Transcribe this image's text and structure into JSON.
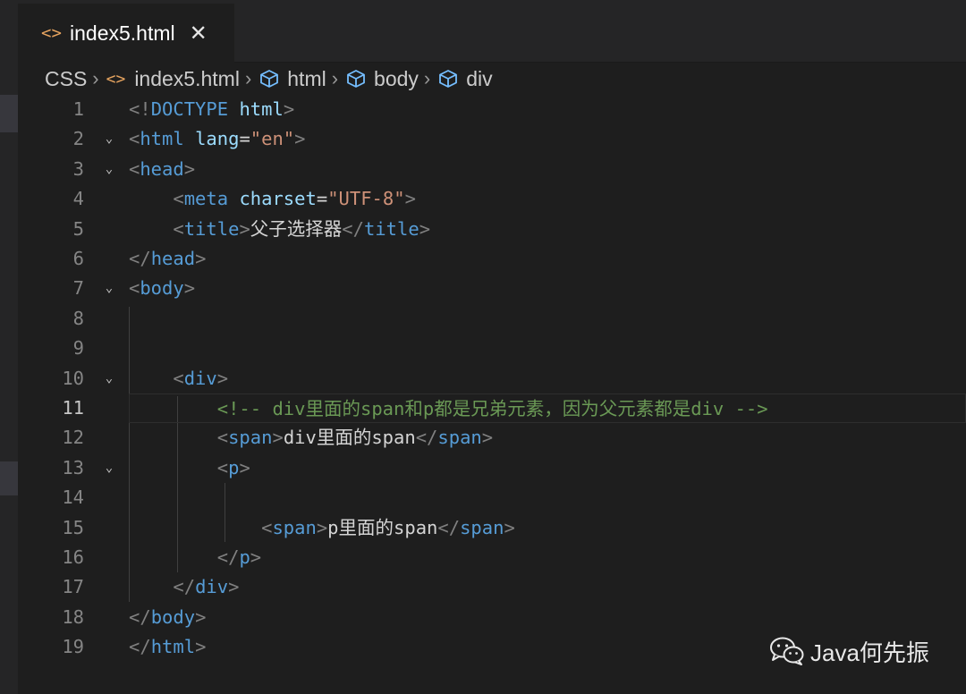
{
  "tab": {
    "icon": "html-tag-icon",
    "filename": "index5.html",
    "close_icon": "close-icon"
  },
  "breadcrumb": [
    {
      "label": "CSS",
      "icon": ""
    },
    {
      "label": "index5.html",
      "icon": "html-tag-icon"
    },
    {
      "label": "html",
      "icon": "element-cube-icon"
    },
    {
      "label": "body",
      "icon": "element-cube-icon"
    },
    {
      "label": "div",
      "icon": "element-cube-icon"
    }
  ],
  "editor": {
    "active_line": 11,
    "lines": [
      {
        "n": "1",
        "text": "<!DOCTYPE html>"
      },
      {
        "n": "2",
        "text": "<html lang=\"en\">"
      },
      {
        "n": "3",
        "text": "<head>"
      },
      {
        "n": "4",
        "text": "    <meta charset=\"UTF-8\">"
      },
      {
        "n": "5",
        "text": "    <title>父子选择器</title>"
      },
      {
        "n": "6",
        "text": "</head>"
      },
      {
        "n": "7",
        "text": "<body>"
      },
      {
        "n": "8",
        "text": ""
      },
      {
        "n": "9",
        "text": ""
      },
      {
        "n": "10",
        "text": "    <div>"
      },
      {
        "n": "11",
        "text": "        <!-- div里面的span和p都是兄弟元素，因为父元素都是div -->"
      },
      {
        "n": "12",
        "text": "        <span>div里面的span</span>"
      },
      {
        "n": "13",
        "text": "        <p>"
      },
      {
        "n": "14",
        "text": ""
      },
      {
        "n": "15",
        "text": "            <span>p里面的span</span>"
      },
      {
        "n": "16",
        "text": "        </p>"
      },
      {
        "n": "17",
        "text": "    </div>"
      },
      {
        "n": "18",
        "text": "</body>"
      },
      {
        "n": "19",
        "text": "</html>"
      }
    ]
  },
  "watermark": {
    "icon": "wechat-icon",
    "text": "Java何先振"
  },
  "colors": {
    "background": "#1e1e1e",
    "tag": "#569cd6",
    "attribute": "#9cdcfe",
    "string": "#ce9178",
    "comment": "#6a9955",
    "bracket": "#808080",
    "text": "#d4d4d4"
  }
}
